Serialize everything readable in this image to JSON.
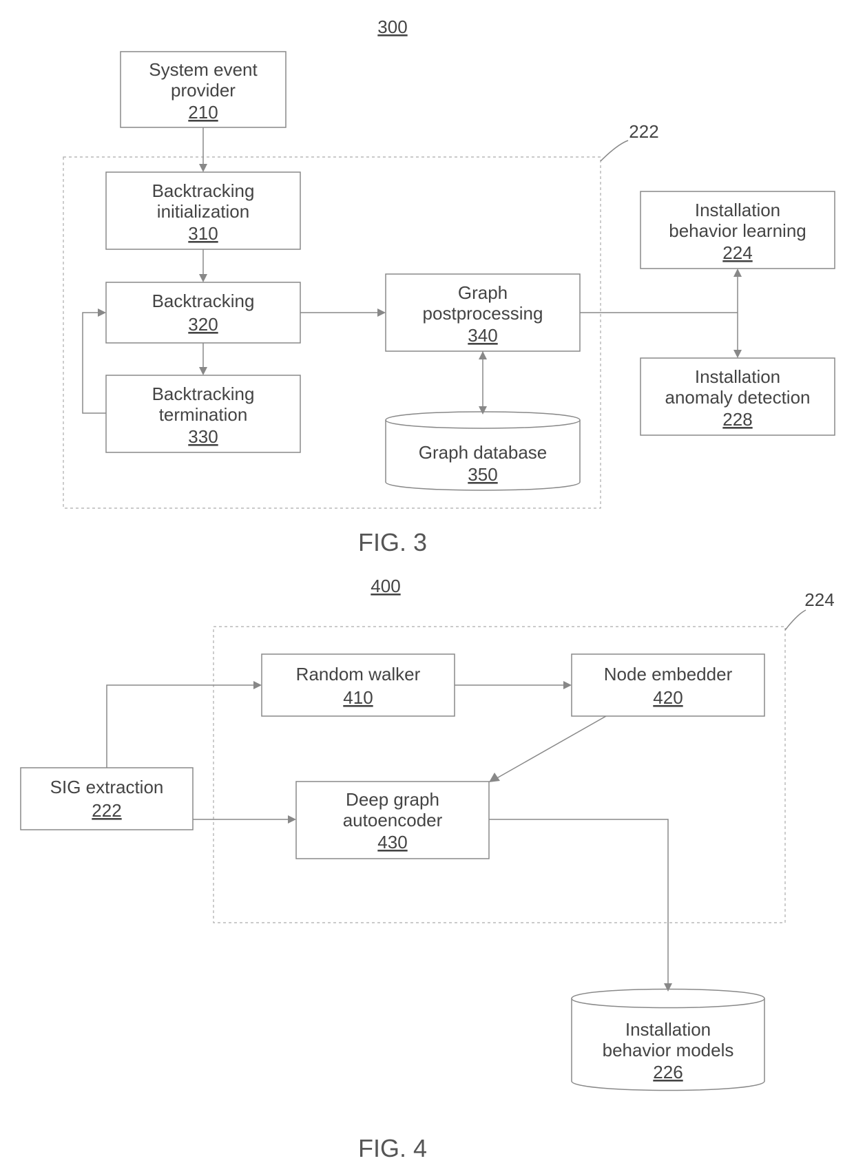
{
  "fig3": {
    "number_label": "300",
    "caption": "FIG. 3",
    "group_label": "222",
    "boxes": {
      "sys_event_provider": {
        "l1": "System event",
        "l2": "provider",
        "ref": "210"
      },
      "bt_init": {
        "l1": "Backtracking",
        "l2": "initialization",
        "ref": "310"
      },
      "bt": {
        "l1": "Backtracking",
        "ref": "320"
      },
      "bt_term": {
        "l1": "Backtracking",
        "l2": "termination",
        "ref": "330"
      },
      "g_post": {
        "l1": "Graph",
        "l2": "postprocessing",
        "ref": "340"
      },
      "g_db": {
        "l1": "Graph database",
        "ref": "350"
      },
      "inst_learn": {
        "l1": "Installation",
        "l2": "behavior learning",
        "ref": "224"
      },
      "inst_anom": {
        "l1": "Installation",
        "l2": "anomaly detection",
        "ref": "228"
      }
    }
  },
  "fig4": {
    "number_label": "400",
    "caption": "FIG. 4",
    "group_label": "224",
    "boxes": {
      "sig_ext": {
        "l1": "SIG extraction",
        "ref": "222"
      },
      "rand_walk": {
        "l1": "Random walker",
        "ref": "410"
      },
      "node_emb": {
        "l1": "Node embedder",
        "ref": "420"
      },
      "dga": {
        "l1": "Deep graph",
        "l2": "autoencoder",
        "ref": "430"
      },
      "models": {
        "l1": "Installation",
        "l2": "behavior models",
        "ref": "226"
      }
    }
  }
}
